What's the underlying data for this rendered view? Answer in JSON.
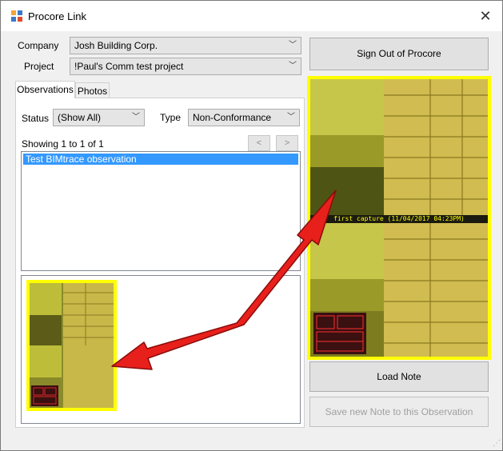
{
  "window": {
    "title": "Procore Link",
    "close_glyph": "✕"
  },
  "form": {
    "company_label": "Company",
    "company_value": "Josh Building Corp.",
    "project_label": "Project",
    "project_value": "!Paul's Comm test project"
  },
  "buttons": {
    "sign_out": "Sign Out of Procore",
    "load_note": "Load Note",
    "save_note": "Save new Note to this Observation"
  },
  "tabs": [
    {
      "label": "Observations",
      "active": true
    },
    {
      "label": "Photos",
      "active": false
    }
  ],
  "filters": {
    "status_label": "Status",
    "status_value": "(Show All)",
    "type_label": "Type",
    "type_value": "Non-Conformance"
  },
  "list": {
    "showing_text": "Showing 1 to 1 of 1",
    "prev_glyph": "<",
    "next_glyph": ">",
    "items": [
      "Test BIMtrace observation"
    ]
  },
  "preview": {
    "caption": "first capture (11/04/2017 04:23PM)"
  },
  "icons": {
    "app": "procore-app-icon",
    "dropdown": "chevron-down-icon",
    "close": "close-icon",
    "arrow": "red-double-arrow-annotation"
  },
  "colors": {
    "highlight": "#ffff00",
    "selection": "#3399ff",
    "annotation": "#e8201c"
  }
}
